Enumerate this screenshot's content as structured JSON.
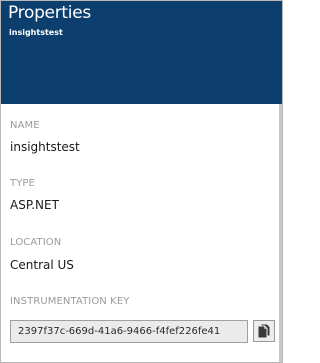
{
  "header": {
    "title": "Properties",
    "subtitle": "insightstest"
  },
  "fields": {
    "name": {
      "label": "NAME",
      "value": "insightstest"
    },
    "type": {
      "label": "TYPE",
      "value": "ASP.NET"
    },
    "location": {
      "label": "LOCATION",
      "value": "Central US"
    },
    "instrumentation_key": {
      "label": "INSTRUMENTATION KEY",
      "value": "2397f37c-669d-41a6-9466-f4fef226fe41"
    }
  },
  "icons": {
    "copy": "copy-icon"
  },
  "colors": {
    "header_bg": "#0d3f6e",
    "label_gray": "#9a9a9a"
  }
}
